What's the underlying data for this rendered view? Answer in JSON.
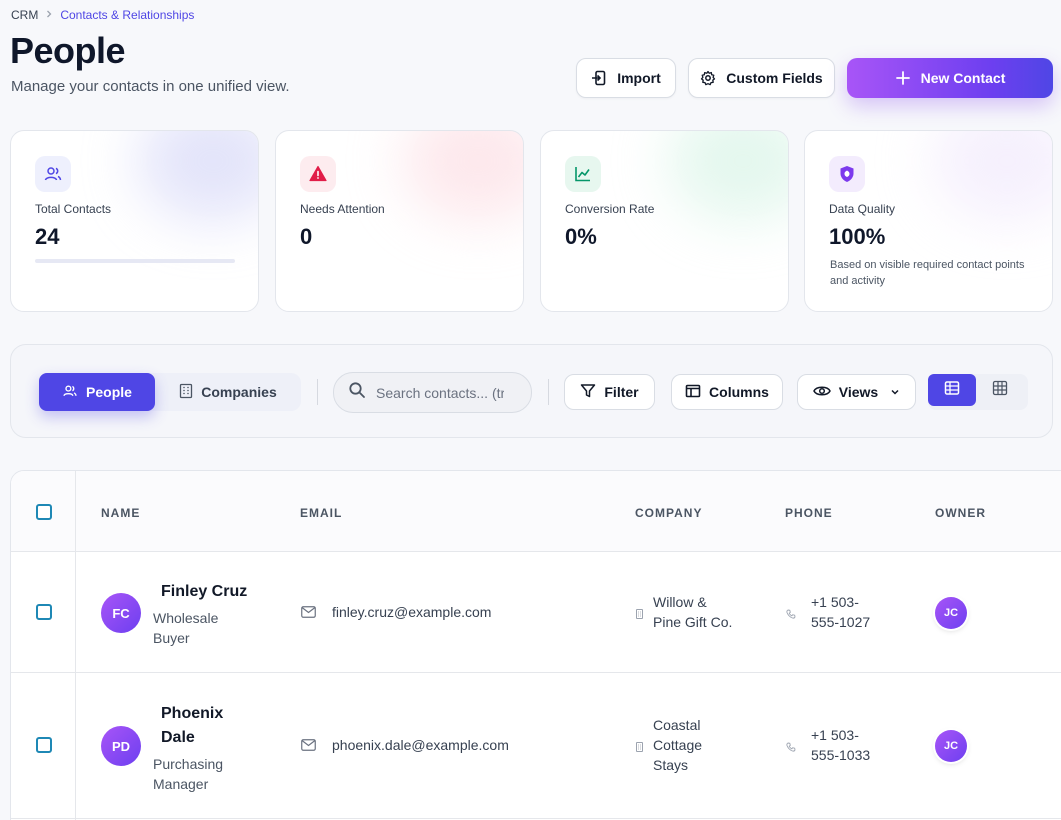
{
  "breadcrumb": {
    "root": "CRM",
    "separator": ">",
    "current": "Contacts & Relationships"
  },
  "page": {
    "title": "People",
    "subtitle": "Manage your contacts in one unified view."
  },
  "actions": {
    "import": "Import",
    "custom_fields": "Custom Fields",
    "new_contact": "New Contact"
  },
  "stats": [
    {
      "label": "Total Contacts",
      "value": "24",
      "icon": "users-icon",
      "accent": "#6366f1"
    },
    {
      "label": "Needs Attention",
      "value": "0",
      "icon": "warning-icon",
      "accent": "#e11d48"
    },
    {
      "label": "Conversion Rate",
      "value": "0%",
      "icon": "trend-icon",
      "accent": "#059669"
    },
    {
      "label": "Data Quality",
      "value": "100%",
      "icon": "shield-icon",
      "accent": "#7c3aed",
      "note": "Based on visible required contact points and activity"
    }
  ],
  "toolbar": {
    "tab_people": "People",
    "tab_companies": "Companies",
    "search_placeholder": "Search contacts... (try",
    "filter": "Filter",
    "columns": "Columns",
    "views": "Views"
  },
  "table": {
    "headers": {
      "name": "NAME",
      "email": "EMAIL",
      "company": "COMPANY",
      "phone": "PHONE",
      "owner": "OWNER"
    },
    "rows": [
      {
        "initials": "FC",
        "name": "Finley Cruz",
        "role_line1": "Wholesale",
        "role_line2": "Buyer",
        "email": "finley.cruz@example.com",
        "company_line1": "Willow &",
        "company_line2": "Pine Gift Co.",
        "phone_line1": "+1 503-",
        "phone_line2": "555-1027",
        "owner": "JC"
      },
      {
        "initials": "PD",
        "name_line1": "Phoenix",
        "name_line2": "Dale",
        "role_line1": "Purchasing",
        "role_line2": "Manager",
        "email": "phoenix.dale@example.com",
        "company_line1": "Coastal",
        "company_line2": "Cottage",
        "company_line3": "Stays",
        "phone_line1": "+1 503-",
        "phone_line2": "555-1033",
        "owner": "JC"
      }
    ]
  },
  "colors": {
    "primary": "#4f46e5",
    "gradient_start": "#a855f7",
    "checkbox": "#1e88b5"
  }
}
